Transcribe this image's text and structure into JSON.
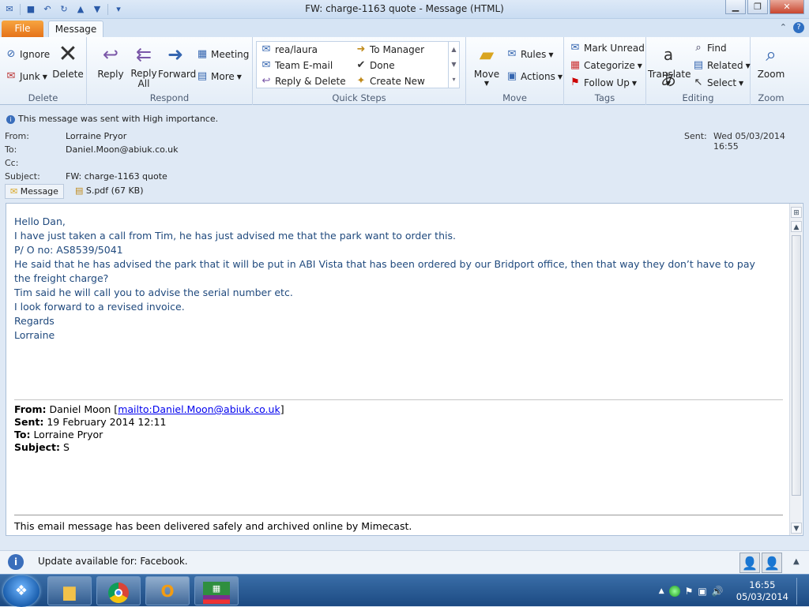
{
  "window": {
    "title": "FW: charge-1163 quote  -  Message (HTML)"
  },
  "tabs": {
    "file": "File",
    "message": "Message"
  },
  "ribbon": {
    "delete_group": {
      "label": "Delete",
      "ignore": "Ignore",
      "junk": "Junk",
      "delete": "Delete"
    },
    "respond_group": {
      "label": "Respond",
      "reply": "Reply",
      "reply_all_1": "Reply",
      "reply_all_2": "All",
      "forward": "Forward",
      "meeting": "Meeting",
      "more": "More"
    },
    "quick_steps": {
      "label": "Quick Steps",
      "items": [
        "rea/laura",
        "To Manager",
        "Team E-mail",
        "Done",
        "Reply & Delete",
        "Create New"
      ]
    },
    "move_group": {
      "label": "Move",
      "move": "Move",
      "rules": "Rules",
      "actions": "Actions"
    },
    "tags_group": {
      "label": "Tags",
      "mark_unread": "Mark Unread",
      "categorize": "Categorize",
      "follow_up": "Follow Up"
    },
    "editing_group": {
      "label": "Editing",
      "translate": "Translate",
      "find": "Find",
      "related": "Related",
      "select": "Select"
    },
    "zoom_group": {
      "label": "Zoom",
      "zoom": "Zoom"
    }
  },
  "info": {
    "importance": "This message was sent with High importance."
  },
  "header": {
    "from_label": "From:",
    "from": "Lorraine Pryor",
    "to_label": "To:",
    "to": "Daniel.Moon@abiuk.co.uk",
    "cc_label": "Cc:",
    "subject_label": "Subject:",
    "subject": "FW: charge-1163 quote",
    "sent_label": "Sent:",
    "sent": "Wed 05/03/2014 16:55"
  },
  "attachments": {
    "message_tab": "Message",
    "file": "S.pdf (67 KB)"
  },
  "body": {
    "lines": [
      "Hello Dan,",
      "I have just taken a call from Tim, he has just advised me that the park want to order this.",
      "P/ O no: AS8539/5041",
      "He said that he has advised the park that it will be put in ABI Vista that has been ordered by our Bridport office, then that way they don’t have to pay",
      "the freight charge?",
      "Tim said he will call you to advise the serial number etc.",
      "I look forward to a revised invoice.",
      "Regards",
      "Lorraine"
    ],
    "forwarded": {
      "from_label": "From:",
      "from_name": "Daniel Moon",
      "from_link": "mailto:Daniel.Moon@abiuk.co.uk",
      "sent_label": "Sent:",
      "sent": "19 February 2014 12:11",
      "to_label": "To:",
      "to": "Lorraine Pryor",
      "subject_label": "Subject:",
      "subject": "S"
    },
    "footer": "This email message has been delivered safely and archived online by Mimecast."
  },
  "notification": {
    "text": "Update available for: Facebook."
  },
  "taskbar": {
    "time": "16:55",
    "date": "05/03/2014"
  }
}
